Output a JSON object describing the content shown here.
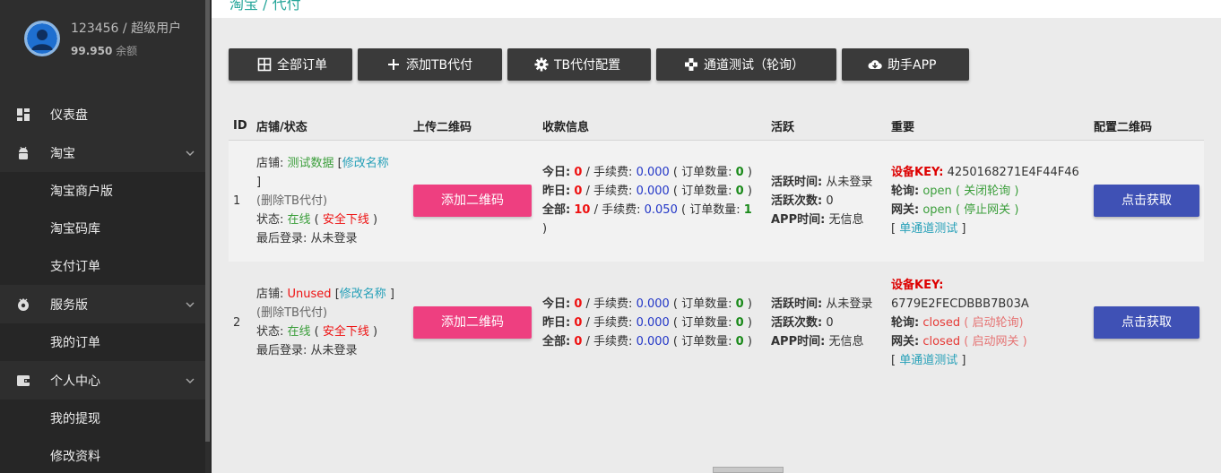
{
  "user": {
    "name": "123456",
    "separator": "/",
    "role": "超级用户",
    "balance": "99.950",
    "balance_label": "余额"
  },
  "nav": {
    "dashboard": "仪表盘",
    "taobao": "淘宝",
    "taobao_merchant": "淘宝商户版",
    "taobao_code": "淘宝码库",
    "pay_orders": "支付订单",
    "service": "服务版",
    "my_orders": "我的订单",
    "personal": "个人中心",
    "my_withdraw": "我的提现",
    "edit_profile": "修改资料"
  },
  "breadcrumb": "淘宝 / 代付",
  "toolbar": {
    "all_orders": "全部订单",
    "add_tb": "添加TB代付",
    "tb_config": "TB代付配置",
    "channel_test": "通道测试（轮询）",
    "helper_app": "助手APP"
  },
  "table": {
    "headers": {
      "id": "ID",
      "shop": "店铺/状态",
      "upload": "上传二维码",
      "income": "收款信息",
      "active": "活跃",
      "important": "重要",
      "config": "配置二维码"
    },
    "rows": [
      {
        "id": "1",
        "shop_label": "店铺:",
        "shop_name": "测试数据",
        "rename": "修改名称",
        "delete": "删除TB代付",
        "status_label": "状态:",
        "status": "在线",
        "safe_offline": "安全下线",
        "last_login_label": "最后登录:",
        "last_login": "从未登录",
        "add_qr": "添加二维码",
        "today_label": "今日:",
        "today_amount": "0",
        "today_fee": "0.000",
        "today_count": "0",
        "yesterday_label": "昨日:",
        "yesterday_amount": "0",
        "yesterday_fee": "0.000",
        "yesterday_count": "0",
        "total_label": "全部:",
        "total_amount": "10",
        "total_fee": "0.050",
        "total_count": "1",
        "fee_label": "手续费:",
        "count_label": "订单数量:",
        "active_time_label": "活跃时间:",
        "active_time": "从未登录",
        "active_count_label": "活跃次数:",
        "active_count": "0",
        "app_time_label": "APP时间:",
        "app_time": "无信息",
        "device_key_label": "设备KEY:",
        "device_key": "4250168271E4F44F46",
        "poll_label": "轮询:",
        "poll_state": "open",
        "poll_action": "关闭轮询",
        "gateway_label": "网关:",
        "gateway_state": "open",
        "gateway_action": "停止网关",
        "single_test": "单通道测试",
        "get_button": "点击获取"
      },
      {
        "id": "2",
        "shop_label": "店铺:",
        "shop_name": "Unused",
        "rename": "修改名称",
        "delete": "删除TB代付",
        "status_label": "状态:",
        "status": "在线",
        "safe_offline": "安全下线",
        "last_login_label": "最后登录:",
        "last_login": "从未登录",
        "add_qr": "添加二维码",
        "today_label": "今日:",
        "today_amount": "0",
        "today_fee": "0.000",
        "today_count": "0",
        "yesterday_label": "昨日:",
        "yesterday_amount": "0",
        "yesterday_fee": "0.000",
        "yesterday_count": "0",
        "total_label": "全部:",
        "total_amount": "0",
        "total_fee": "0.000",
        "total_count": "0",
        "fee_label": "手续费:",
        "count_label": "订单数量:",
        "active_time_label": "活跃时间:",
        "active_time": "从未登录",
        "active_count_label": "活跃次数:",
        "active_count": "0",
        "app_time_label": "APP时间:",
        "app_time": "无信息",
        "device_key_label": "设备KEY:",
        "device_key": "6779E2FECDBBB7B03A",
        "poll_label": "轮询:",
        "poll_state": "closed",
        "poll_action": "启动轮询",
        "gateway_label": "网关:",
        "gateway_state": "closed",
        "gateway_action": "启动网关",
        "single_test": "单通道测试",
        "get_button": "点击获取"
      }
    ]
  },
  "colors": {
    "sidebar_bg": "#2e2e2e",
    "primary_button": "#3f51b5",
    "pink_button": "#ee3f80",
    "dark_button": "#3a3a3a",
    "online": "#3b9e3b",
    "danger": "#e11111"
  }
}
